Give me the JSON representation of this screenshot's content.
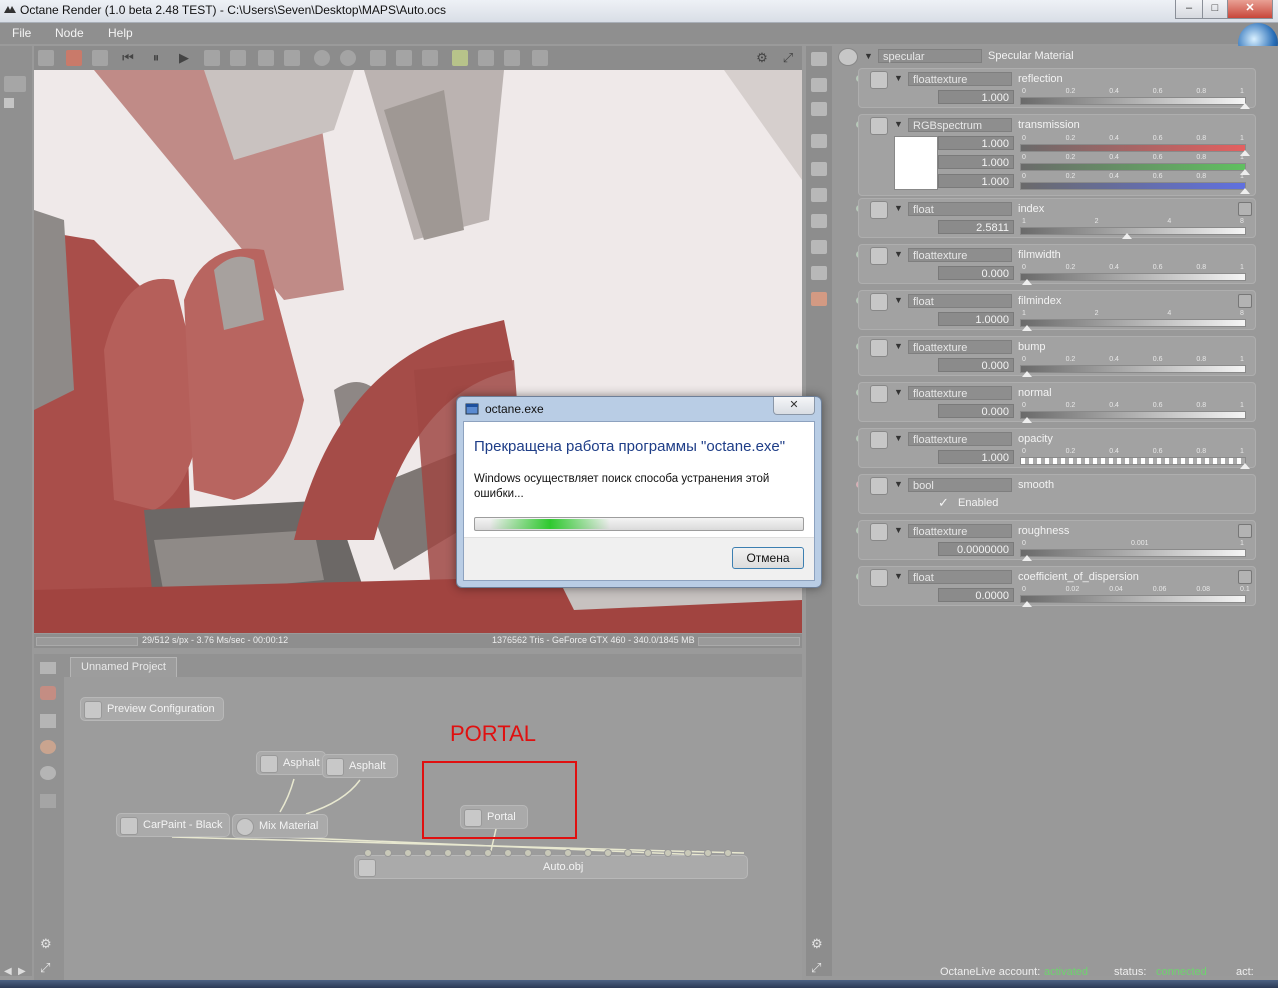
{
  "window": {
    "title": "Octane Render (1.0 beta 2.48 TEST) - C:\\Users\\Seven\\Desktop\\MAPS\\Auto.ocs",
    "controls": {
      "minimize": "–",
      "maximize": "□",
      "close": "✕"
    }
  },
  "menu": [
    "File",
    "Node",
    "Help"
  ],
  "viewport": {
    "status_left": "29/512 s/px - 3.76 Ms/sec - 00:00:12",
    "status_right": "1376562 Tris - GeForce GTX 460 - 340.0/1845 MB"
  },
  "node_editor": {
    "tab": "Unnamed Project",
    "preview_button": "Preview Configuration",
    "annotation": "PORTAL",
    "nodes": {
      "asphalt1": "Asphalt",
      "asphalt2": "Asphalt",
      "carpaint": "CarPaint - Black",
      "mix": "Mix Material",
      "portal": "Portal",
      "mesh": "Auto.obj"
    }
  },
  "inspector": {
    "material_type": "specular",
    "material_name": "Specular Material",
    "params": [
      {
        "type": "floattexture",
        "name": "reflection",
        "value": "1.000",
        "ticks": [
          "0",
          "0.2",
          "0.4",
          "0.6",
          "0.8",
          "1"
        ]
      },
      {
        "type": "RGBspectrum",
        "name": "transmission",
        "r": "1.000",
        "g": "1.000",
        "b": "1.000",
        "ticks": [
          "0",
          "0.2",
          "0.4",
          "0.6",
          "0.8",
          "1"
        ]
      },
      {
        "type": "float",
        "name": "index",
        "value": "2.5811",
        "ticks": [
          "1",
          "2",
          "4",
          "8"
        ]
      },
      {
        "type": "floattexture",
        "name": "filmwidth",
        "value": "0.000",
        "ticks": [
          "0",
          "0.2",
          "0.4",
          "0.6",
          "0.8",
          "1"
        ]
      },
      {
        "type": "float",
        "name": "filmindex",
        "value": "1.0000",
        "ticks": [
          "1",
          "2",
          "4",
          "8"
        ]
      },
      {
        "type": "floattexture",
        "name": "bump",
        "value": "0.000",
        "ticks": [
          "0",
          "0.2",
          "0.4",
          "0.6",
          "0.8",
          "1"
        ]
      },
      {
        "type": "floattexture",
        "name": "normal",
        "value": "0.000",
        "ticks": [
          "0",
          "0.2",
          "0.4",
          "0.6",
          "0.8",
          "1"
        ]
      },
      {
        "type": "floattexture",
        "name": "opacity",
        "value": "1.000",
        "ticks": [
          "0",
          "0.2",
          "0.4",
          "0.6",
          "0.8",
          "1"
        ]
      },
      {
        "type": "bool",
        "name": "smooth",
        "checkbox_label": "Enabled",
        "checked": true
      },
      {
        "type": "floattexture",
        "name": "roughness",
        "value": "0.0000000",
        "ticks": [
          "0",
          "0.001",
          "1"
        ]
      },
      {
        "type": "float",
        "name": "coefficient_of_dispersion",
        "value": "0.0000",
        "ticks": [
          "0",
          "0.02",
          "0.04",
          "0.06",
          "0.08",
          "0.1"
        ]
      }
    ]
  },
  "dialog": {
    "title": "octane.exe",
    "heading": "Прекращена работа программы \"octane.exe\"",
    "message": "Windows осуществляет поиск способа устранения этой ошибки...",
    "progress": 0.35,
    "cancel": "Отмена",
    "close": "✕"
  },
  "status": {
    "account_label": "OctaneLive account:",
    "account_value": "activated",
    "status_label": "status:",
    "status_value": "connected",
    "act_label": "act:",
    "accent_green": "#6fd36f"
  }
}
